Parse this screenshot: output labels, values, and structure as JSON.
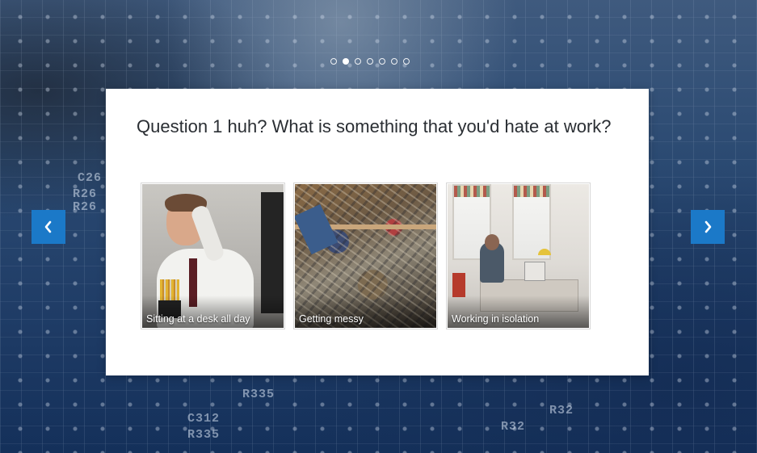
{
  "carousel": {
    "dots": [
      {
        "label": "Slide 1",
        "active": false
      },
      {
        "label": "Slide 2",
        "active": true
      },
      {
        "label": "Slide 3",
        "active": false
      },
      {
        "label": "Slide 4",
        "active": false
      },
      {
        "label": "Slide 5",
        "active": false
      },
      {
        "label": "Slide 6",
        "active": false
      },
      {
        "label": "Slide 7",
        "active": false
      }
    ],
    "prev_icon": "chevron-left-icon",
    "next_icon": "chevron-right-icon",
    "accent_color": "#1b79c8"
  },
  "card": {
    "question": "Question 1 huh? What is something that you'd hate at work?",
    "options": [
      {
        "caption": "Sitting at a desk all day"
      },
      {
        "caption": "Getting messy"
      },
      {
        "caption": "Working in isolation"
      }
    ]
  },
  "background": {
    "labels": [
      "C26",
      "R26",
      "R26",
      "C312",
      "R335",
      "R335",
      "R32",
      "R32"
    ]
  }
}
